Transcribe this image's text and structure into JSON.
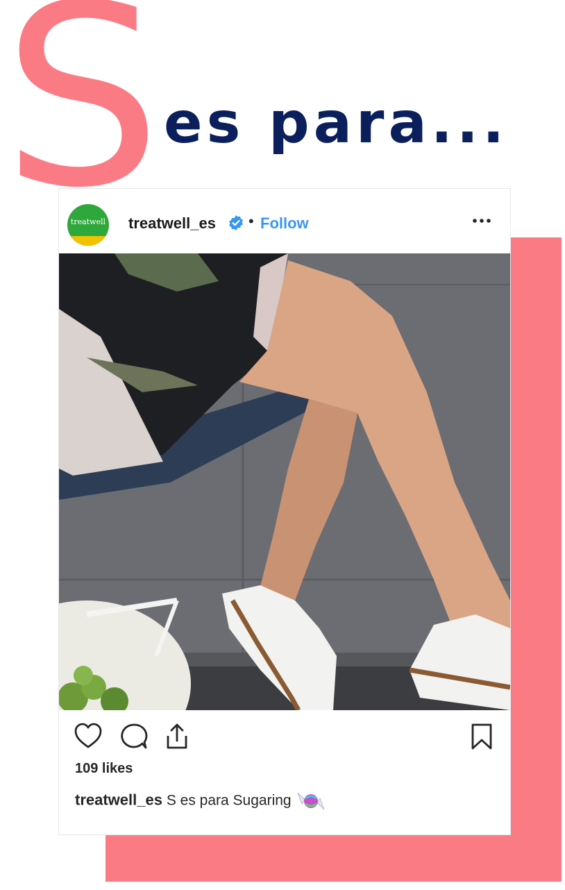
{
  "heading": {
    "letter": "S",
    "text": "es para..."
  },
  "post": {
    "username": "treatwell_es",
    "avatar_text": "treatwell",
    "separator": "•",
    "follow_label": "Follow",
    "likes": "109 likes",
    "caption_user": "treatwell_es",
    "caption_text": "S es para Sugaring"
  },
  "icons": {
    "verified": "verified-badge-icon",
    "more": "more-options-icon",
    "like": "heart-icon",
    "comment": "comment-icon",
    "share": "share-icon",
    "save": "bookmark-icon",
    "emoji": "candy-icon"
  },
  "colors": {
    "accent_pink": "#fb7b85",
    "headline_navy": "#0a1f5c",
    "link_blue": "#3897f0",
    "brand_green": "#2ea83a",
    "brand_yellow": "#f2c200"
  }
}
